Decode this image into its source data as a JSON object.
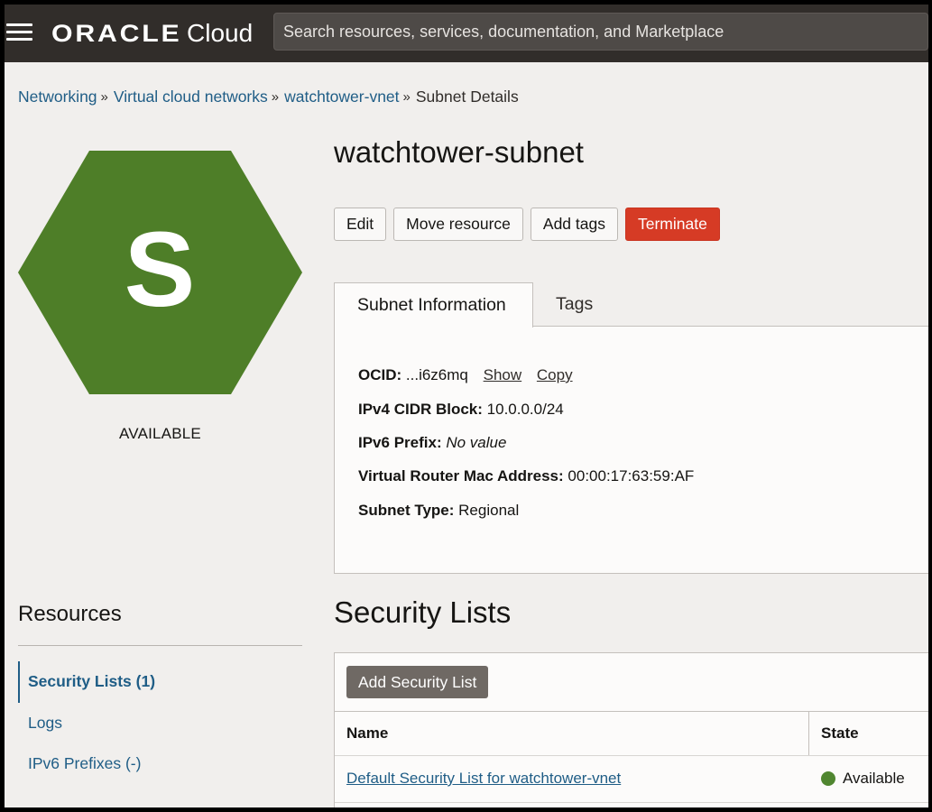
{
  "header": {
    "brand_oracle": "ORACLE",
    "brand_cloud": "Cloud",
    "search_placeholder": "Search resources, services, documentation, and Marketplace"
  },
  "breadcrumb": [
    {
      "label": "Networking",
      "link": true
    },
    {
      "label": "Virtual cloud networks",
      "link": true
    },
    {
      "label": "watchtower-vnet",
      "link": true
    },
    {
      "label": "Subnet Details",
      "link": false
    }
  ],
  "breadcrumb_separator": "»",
  "resource": {
    "icon_letter": "S",
    "icon_color": "#4e7e28",
    "status": "AVAILABLE",
    "title": "watchtower-subnet"
  },
  "actions": {
    "edit": "Edit",
    "move": "Move resource",
    "add_tags": "Add tags",
    "terminate": "Terminate"
  },
  "tabs": {
    "info": "Subnet Information",
    "tags": "Tags"
  },
  "info": {
    "ocid_label": "OCID:",
    "ocid_value": "...i6z6mq",
    "show": "Show",
    "copy": "Copy",
    "ipv4_label": "IPv4 CIDR Block:",
    "ipv4_value": "10.0.0.0/24",
    "ipv6_label": "IPv6 Prefix:",
    "ipv6_value": "No value",
    "mac_label": "Virtual Router Mac Address:",
    "mac_value": "00:00:17:63:59:AF",
    "type_label": "Subnet Type:",
    "type_value": "Regional"
  },
  "resources": {
    "title": "Resources",
    "items": [
      "Security Lists (1)",
      "Logs",
      "IPv6 Prefixes (-)"
    ]
  },
  "security_lists": {
    "title": "Security Lists",
    "add_button": "Add Security List",
    "columns": [
      "Name",
      "State"
    ],
    "rows": [
      {
        "name": "Default Security List for watchtower-vnet",
        "state": "Available"
      }
    ]
  },
  "colors": {
    "topbar": "#312d2a",
    "link": "#1f5d86",
    "terminate": "#d63b25",
    "available_dot": "#508630"
  }
}
